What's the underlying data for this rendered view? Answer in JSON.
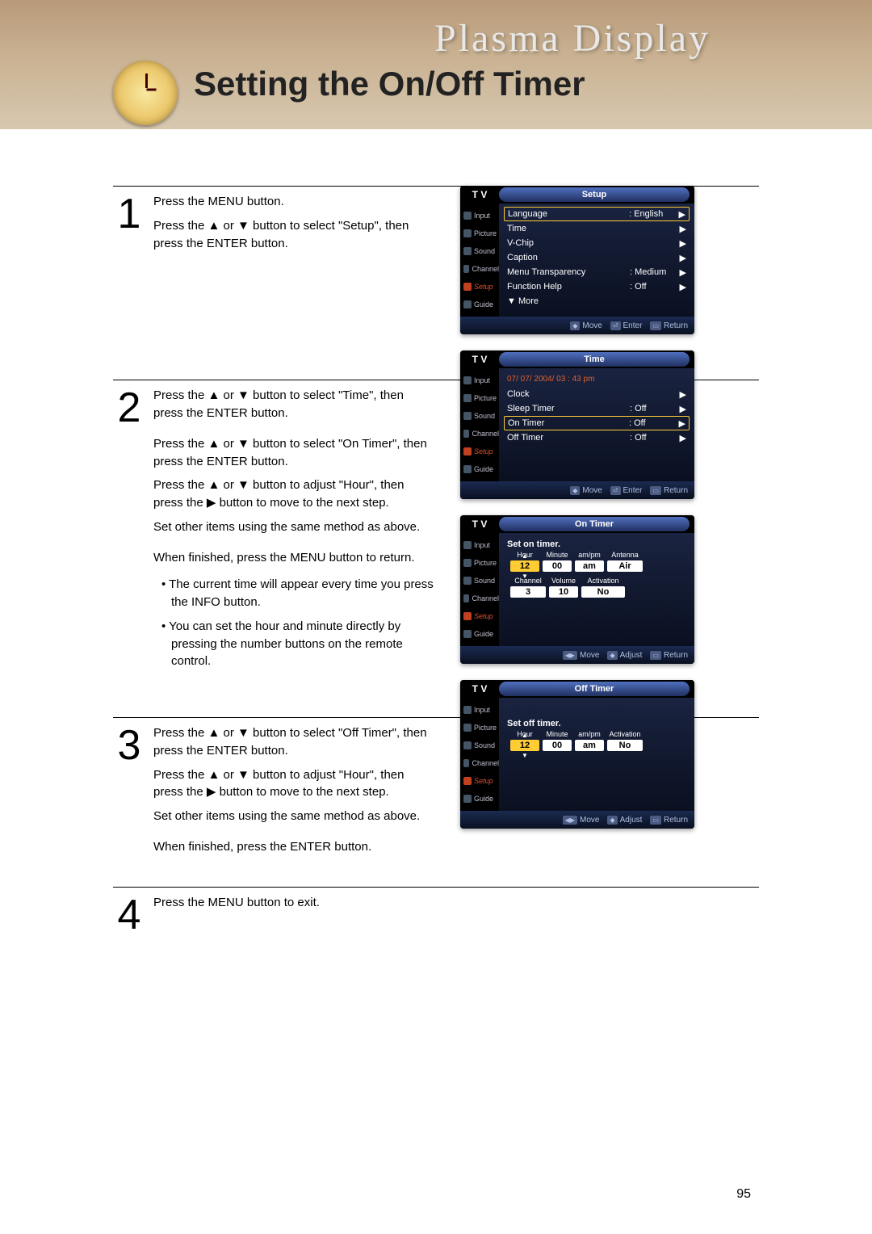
{
  "banner_title": "Plasma Display",
  "page_heading": "Setting the On/Off Timer",
  "page_number": "95",
  "steps": {
    "1": {
      "num": "1",
      "paragraphs": [
        "Press the MENU button.",
        "Press the ▲ or ▼ button to select \"Setup\", then press the ENTER button."
      ]
    },
    "2": {
      "num": "2",
      "paragraphs": [
        "Press the ▲ or ▼ button to select \"Time\", then press the ENTER button.",
        "Press the ▲ or ▼ button to select \"On Timer\", then press the ENTER button.",
        "Press the ▲ or ▼ button to adjust \"Hour\", then press the ▶ button to move to the next step.",
        "Set other items using the same method as above.",
        "When finished, press the MENU button to return."
      ],
      "bullets": [
        "• The current time will appear every time you press the INFO button.",
        "• You can set the hour and minute directly by pressing the number buttons on the remote control."
      ]
    },
    "3": {
      "num": "3",
      "paragraphs": [
        "Press the ▲ or ▼ button to select \"Off Timer\", then press the ENTER button.",
        "Press the ▲ or ▼ button to adjust \"Hour\", then press the ▶ button to move to the next step.",
        "Set other items using the same method as above.",
        "When finished, press the ENTER button."
      ]
    },
    "4": {
      "num": "4",
      "paragraphs": [
        "Press the MENU button to exit."
      ]
    }
  },
  "sidebar": [
    "Input",
    "Picture",
    "Sound",
    "Channel",
    "Setup",
    "Guide"
  ],
  "osd": {
    "tv_label": "T V",
    "footer": {
      "move": "Move",
      "enter": "Enter",
      "return": "Return",
      "adjust": "Adjust",
      "move_icon": "◆",
      "lr_icon": "◀▶",
      "enter_icon": "⏎",
      "return_icon": "▭"
    },
    "setup": {
      "title": "Setup",
      "rows": [
        {
          "label": "Language",
          "value": ": English",
          "hl": true
        },
        {
          "label": "Time",
          "value": ""
        },
        {
          "label": "V-Chip",
          "value": ""
        },
        {
          "label": "Caption",
          "value": ""
        },
        {
          "label": "Menu Transparency",
          "value": ": Medium"
        },
        {
          "label": "Function Help",
          "value": ": Off"
        },
        {
          "label": "▼ More",
          "value": "",
          "nocaret": true
        }
      ]
    },
    "time": {
      "title": "Time",
      "hint": "07/ 07/ 2004/ 03 : 43  pm",
      "rows": [
        {
          "label": "Clock",
          "value": ""
        },
        {
          "label": "Sleep Timer",
          "value": ": Off"
        },
        {
          "label": "On Timer",
          "value": ": Off",
          "hl": true
        },
        {
          "label": "Off Timer",
          "value": ": Off"
        }
      ]
    },
    "on_timer": {
      "title": "On Timer",
      "subhead": "Set on timer.",
      "row1_labels": [
        "Hour",
        "Minute",
        "am/pm",
        "Antenna"
      ],
      "row1_values": [
        {
          "v": "12",
          "hl": true,
          "w": "w36"
        },
        {
          "v": "00",
          "w": "w36"
        },
        {
          "v": "am",
          "w": "w36"
        },
        {
          "v": "Air",
          "w": "w44"
        }
      ],
      "row2_labels": [
        "Channel",
        "Volume",
        "Activation"
      ],
      "row2_values": [
        {
          "v": "3",
          "w": "w44"
        },
        {
          "v": "10",
          "w": "w36"
        },
        {
          "v": "No",
          "w": "w54"
        }
      ]
    },
    "off_timer": {
      "title": "Off Timer",
      "subhead": "Set off timer.",
      "row1_labels": [
        "Hour",
        "Minute",
        "am/pm",
        "Activation"
      ],
      "row1_values": [
        {
          "v": "12",
          "hl": true,
          "w": "w36"
        },
        {
          "v": "00",
          "w": "w36"
        },
        {
          "v": "am",
          "w": "w36"
        },
        {
          "v": "No",
          "w": "w44"
        }
      ]
    }
  }
}
